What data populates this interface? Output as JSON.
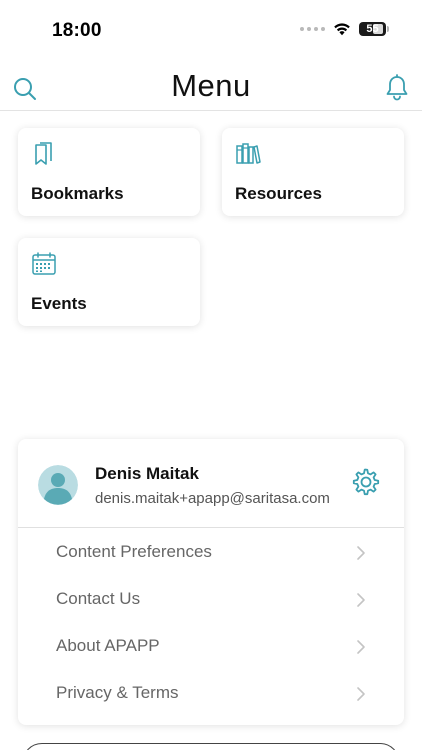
{
  "status_bar": {
    "time": "18:00",
    "battery_level": "55",
    "icons": [
      "signal-dots-icon",
      "wifi-icon",
      "battery-icon"
    ]
  },
  "header": {
    "title": "Menu",
    "left_icon": "search-icon",
    "right_icon": "bell-icon"
  },
  "tiles": [
    {
      "label": "Bookmarks",
      "icon": "bookmarks-icon"
    },
    {
      "label": "Resources",
      "icon": "books-icon"
    },
    {
      "label": "Events",
      "icon": "calendar-icon"
    }
  ],
  "account": {
    "name": "Denis Maitak",
    "email": "denis.maitak+apapp@saritasa.com",
    "avatar_icon": "user-avatar-icon",
    "settings_icon": "gear-icon"
  },
  "menu": [
    {
      "label": "Content Preferences"
    },
    {
      "label": "Contact Us"
    },
    {
      "label": "About APAPP"
    },
    {
      "label": "Privacy & Terms"
    }
  ],
  "colors": {
    "accent": "#3a9fb0",
    "avatar_bg": "#b9dce2",
    "avatar_figure": "#5aaab5",
    "text_primary": "#111111",
    "text_secondary": "#666666",
    "chevron": "#c4c4c4",
    "divider": "#e0e0e0"
  }
}
